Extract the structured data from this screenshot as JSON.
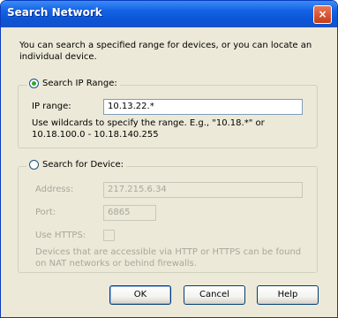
{
  "window": {
    "title": "Search Network",
    "close_label": "×"
  },
  "description": "You can search a specified range for devices, or you can locate an individual device.",
  "range_group": {
    "label": "Search IP Range:",
    "selected": true,
    "ip_range_label": "IP range:",
    "ip_range_value": "10.13.22.*",
    "hint": "Use wildcards to specify the range. E.g., \"10.18.*\" or 10.18.100.0 - 10.18.140.255"
  },
  "device_group": {
    "label": "Search for Device:",
    "selected": false,
    "address_label": "Address:",
    "address_value": "217.215.6.34",
    "port_label": "Port:",
    "port_value": "6865",
    "use_https_label": "Use HTTPS:",
    "use_https_checked": false,
    "note": "Devices that are accessible via HTTP or HTTPS can be found on NAT networks or behind firewalls."
  },
  "buttons": {
    "ok": "OK",
    "cancel": "Cancel",
    "help": "Help"
  }
}
